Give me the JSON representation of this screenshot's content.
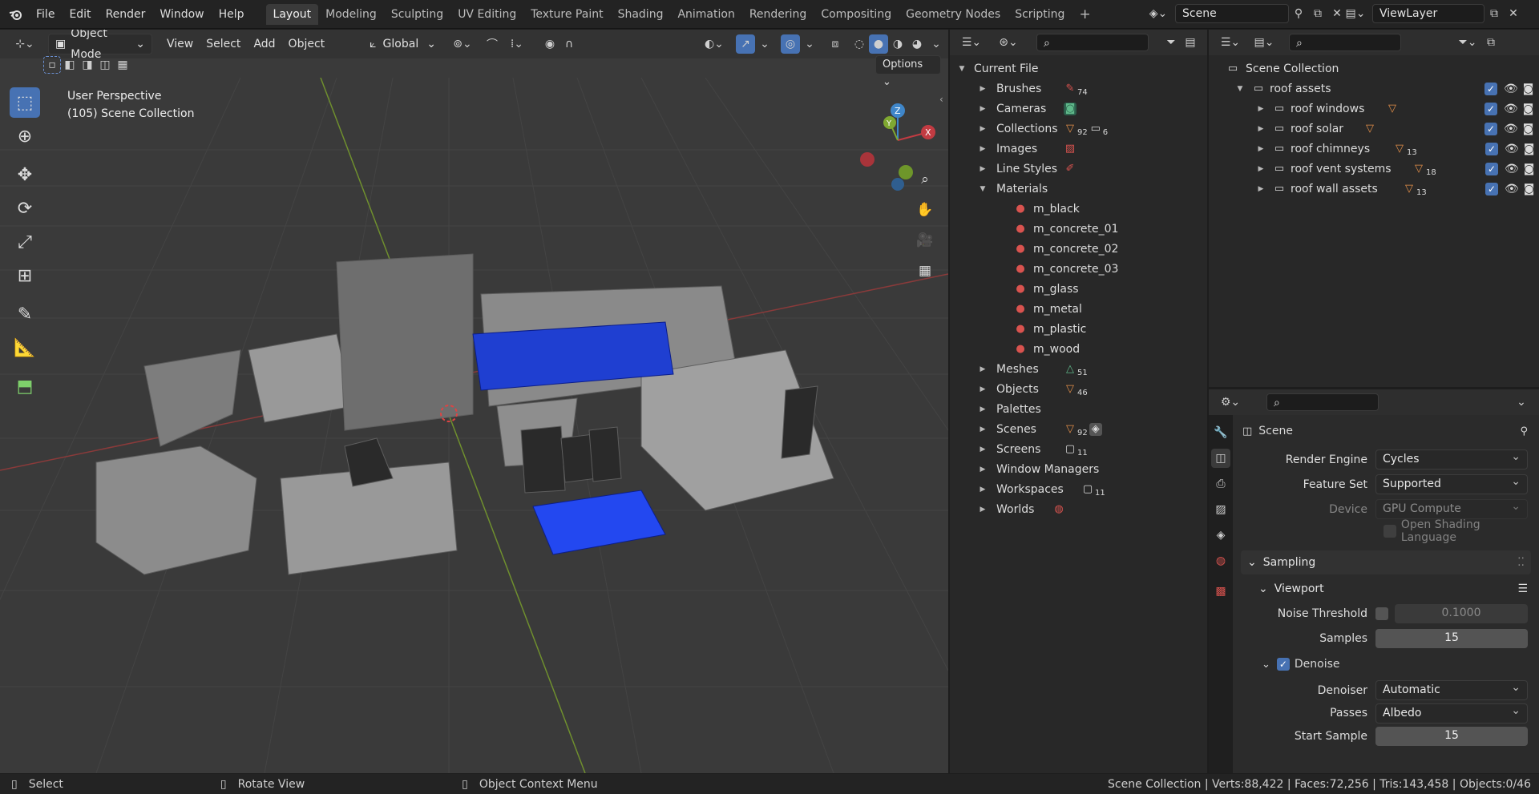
{
  "topbar": {
    "menus": [
      "File",
      "Edit",
      "Render",
      "Window",
      "Help"
    ],
    "workspaces": [
      "Layout",
      "Modeling",
      "Sculpting",
      "UV Editing",
      "Texture Paint",
      "Shading",
      "Animation",
      "Rendering",
      "Compositing",
      "Geometry Nodes",
      "Scripting"
    ],
    "active_workspace": "Layout",
    "add_tab": "+",
    "scene_name": "Scene",
    "view_layer": "ViewLayer"
  },
  "viewport": {
    "mode": "Object Mode",
    "menus": [
      "View",
      "Select",
      "Add",
      "Object"
    ],
    "orientation": "Global",
    "options_label": "Options",
    "overlay_line1": "User Perspective",
    "overlay_line2": "(105) Scene Collection",
    "gizmo_axes": {
      "x": "X",
      "y": "Y",
      "z": "Z"
    },
    "colors": {
      "x_axis": "#c23b42",
      "y_axis": "#7fa831",
      "z_axis": "#3f86c9",
      "selected_tool": "#4772b3",
      "panel_blue": "#1f3fd1"
    }
  },
  "outliner": {
    "root": "Current File",
    "items": [
      {
        "label": "Brushes",
        "icon": "brush-icon",
        "count": "74"
      },
      {
        "label": "Cameras",
        "icon": "camera-icon",
        "count": ""
      },
      {
        "label": "Collections",
        "icon": "collection-icon",
        "count": "92",
        "count2": "6"
      },
      {
        "label": "Images",
        "icon": "image-icon",
        "count": ""
      },
      {
        "label": "Line Styles",
        "icon": "linestyle-icon",
        "count": ""
      },
      {
        "label": "Materials",
        "icon": "material-icon",
        "count": ""
      },
      {
        "label": "Meshes",
        "icon": "mesh-icon",
        "count": "51"
      },
      {
        "label": "Objects",
        "icon": "object-icon",
        "count": "46"
      },
      {
        "label": "Palettes",
        "icon": "",
        "count": ""
      },
      {
        "label": "Scenes",
        "icon": "scene-icon",
        "count": "92"
      },
      {
        "label": "Screens",
        "icon": "screen-icon",
        "count": "11"
      },
      {
        "label": "Window Managers",
        "icon": "",
        "count": ""
      },
      {
        "label": "Workspaces",
        "icon": "workspace-icon",
        "count": "11"
      },
      {
        "label": "Worlds",
        "icon": "world-icon",
        "count": ""
      }
    ],
    "materials": [
      "m_black",
      "m_concrete_01",
      "m_concrete_02",
      "m_concrete_03",
      "m_glass",
      "m_metal",
      "m_plastic",
      "m_wood"
    ]
  },
  "scene_outliner": {
    "root": "Scene Collection",
    "parent": "roof assets",
    "children": [
      {
        "label": "roof windows",
        "count": ""
      },
      {
        "label": "roof solar",
        "count": ""
      },
      {
        "label": "roof chimneys",
        "count": "13"
      },
      {
        "label": "roof vent systems",
        "count": "18"
      },
      {
        "label": "roof wall assets",
        "count": "13"
      }
    ]
  },
  "properties": {
    "title": "Scene",
    "render_engine_label": "Render Engine",
    "render_engine": "Cycles",
    "feature_set_label": "Feature Set",
    "feature_set": "Supported",
    "device_label": "Device",
    "device": "GPU Compute",
    "osl_label": "Open Shading Language",
    "sampling_label": "Sampling",
    "viewport_label": "Viewport",
    "noise_threshold_label": "Noise Threshold",
    "noise_threshold": "0.1000",
    "samples_label": "Samples",
    "samples": "15",
    "denoise_label": "Denoise",
    "denoiser_label": "Denoiser",
    "denoiser": "Automatic",
    "passes_label": "Passes",
    "passes": "Albedo",
    "start_sample_label": "Start Sample",
    "start_sample": "15"
  },
  "statusbar": {
    "select": "Select",
    "rotate": "Rotate View",
    "context": "Object Context Menu",
    "stats": "Scene Collection | Verts:88,422 | Faces:72,256 | Tris:143,458 | Objects:0/46"
  }
}
